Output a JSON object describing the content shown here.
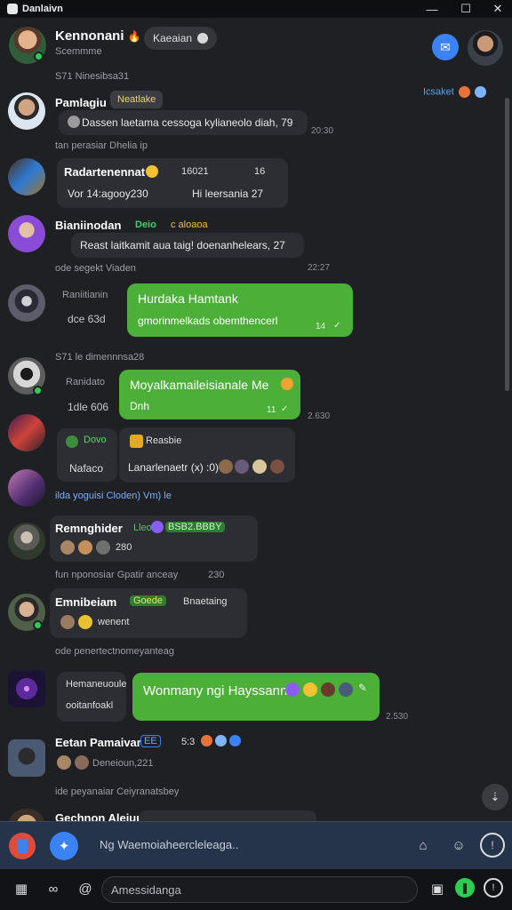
{
  "window": {
    "title": "Danlaivn",
    "min": "—",
    "max": "☐",
    "close": "✕"
  },
  "header": {
    "name": "Kennonani",
    "name_emoji": "🔥",
    "subtitle": "Scemmme",
    "pill_label": "Kaeaian",
    "right_link": "Icsaket"
  },
  "messages": [
    {
      "sender": "Pamlagiu",
      "tag": "Neatlake",
      "text": "Dassen laetama cessoga kylianeolo diah, 79",
      "time": "20:30",
      "meta": "tan perasiar Dhelia ip"
    },
    {
      "sender": "Radartenennat",
      "tag": "16021",
      "tag2": "16",
      "text": "Vor 14:agooy230",
      "text2": "Hi leersania 27"
    },
    {
      "sender": "Bianiinodan",
      "tag": "Deio",
      "tag2": "c aloaoa",
      "text": "Reast laitkamit aua taig! doenanhelears, 27",
      "time": "22:27",
      "meta": "ode segekt Viaden"
    },
    {
      "sender": "Raniitianin",
      "sub": "dce 63d",
      "text": "Hurdaka Hamtank",
      "text2": "gmorinmelkads obemthencerl",
      "time": "14"
    },
    {
      "sender": "Ranidato",
      "sub": "1dle 606",
      "text": "Moyalkamaileisianale Me",
      "text2": "Dnh",
      "time": "11",
      "time_right": "2.630",
      "meta": "Bt1 le ehnemesa"
    },
    {
      "sender": "Dovo",
      "sub": "Nafaco",
      "tag": "Reasbie",
      "text": "Lanarlenaetr (x) :0)",
      "meta": "ilda yoguisi Cloden) Vm) le"
    },
    {
      "sender": "Remnghider",
      "tag": "Lleo",
      "tag2": "BSB2.BBBY",
      "text": "280",
      "meta": "fun nponosiar Gpatir anceay",
      "time": "230"
    },
    {
      "sender": "Emnibeiam",
      "tag": "Goede",
      "tag2": "Bnaetaing",
      "text": "wenent",
      "meta": "ode penertectnomeyanteag"
    },
    {
      "sender": "Hemaneuoule",
      "sub": "ooitanfoakl",
      "text": "Wonmany ngi Hayssann",
      "time": "2.530"
    },
    {
      "sender": "Eetan Pamaivar",
      "tag": "EE",
      "tag2": "5:3",
      "text": "Deneioun,221",
      "meta": "ide peyanaiar Ceiyranatsbey"
    },
    {
      "sender": "Gechnon Aleiuui"
    }
  ],
  "separators": [
    "S71 Ninesibsa31",
    "S71 le dimennnsa28"
  ],
  "composer": {
    "placeholder": "Ng Waemoiaheercleleaga.."
  },
  "search": {
    "placeholder": "Amessidanga"
  },
  "colors": {
    "bg": "#1f2024",
    "bubble": "#2c2e33",
    "green": "#4caf38",
    "accent": "#3b82f6"
  }
}
